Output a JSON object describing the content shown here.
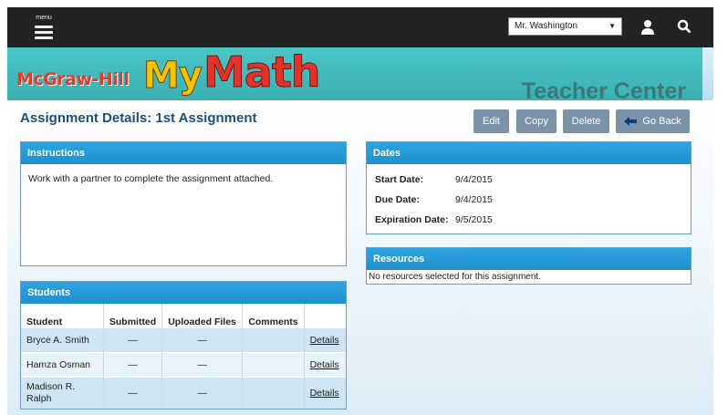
{
  "topbar": {
    "menu_label": "menu",
    "teacher_select": "Mr. Washington",
    "bg": "#222222"
  },
  "banner": {
    "logo_publisher": "McGraw-Hill",
    "logo_my": "My",
    "logo_math": "Math",
    "subtitle": "Teacher Center",
    "bg": "#42bcbd"
  },
  "page": {
    "title": "Assignment Details: 1st Assignment"
  },
  "actions": {
    "edit": "Edit",
    "copy": "Copy",
    "delete": "Delete",
    "go_back": "Go Back"
  },
  "instructions": {
    "header": "Instructions",
    "text": "Work with a partner to complete the assignment attached."
  },
  "dates": {
    "header": "Dates",
    "rows": [
      {
        "label": "Start Date:",
        "value": "9/4/2015"
      },
      {
        "label": "Due Date:",
        "value": "9/4/2015"
      },
      {
        "label": "Expiration Date:",
        "value": "9/5/2015"
      }
    ]
  },
  "resources": {
    "header": "Resources",
    "text": "No resources selected for this assignment."
  },
  "students": {
    "header": "Students",
    "columns": [
      "Student",
      "Submitted",
      "Uploaded Files",
      "Comments",
      ""
    ],
    "rows": [
      {
        "name": "Bryce A. Smith",
        "submitted": "—",
        "files": "—",
        "comments": "",
        "link": "Details"
      },
      {
        "name": "Hamza Osman",
        "submitted": "—",
        "files": "—",
        "comments": "",
        "link": "Details"
      },
      {
        "name": "Madison R. Ralph",
        "submitted": "—",
        "files": "—",
        "comments": "",
        "link": "Details"
      }
    ]
  },
  "colors": {
    "panel_header": "#2199d6",
    "button": "#7b93a8",
    "title": "#1f4f7a"
  },
  "icons": {
    "menu": "hamburger-icon",
    "user": "user-icon",
    "search": "search-icon",
    "back": "arrow-left-icon"
  }
}
